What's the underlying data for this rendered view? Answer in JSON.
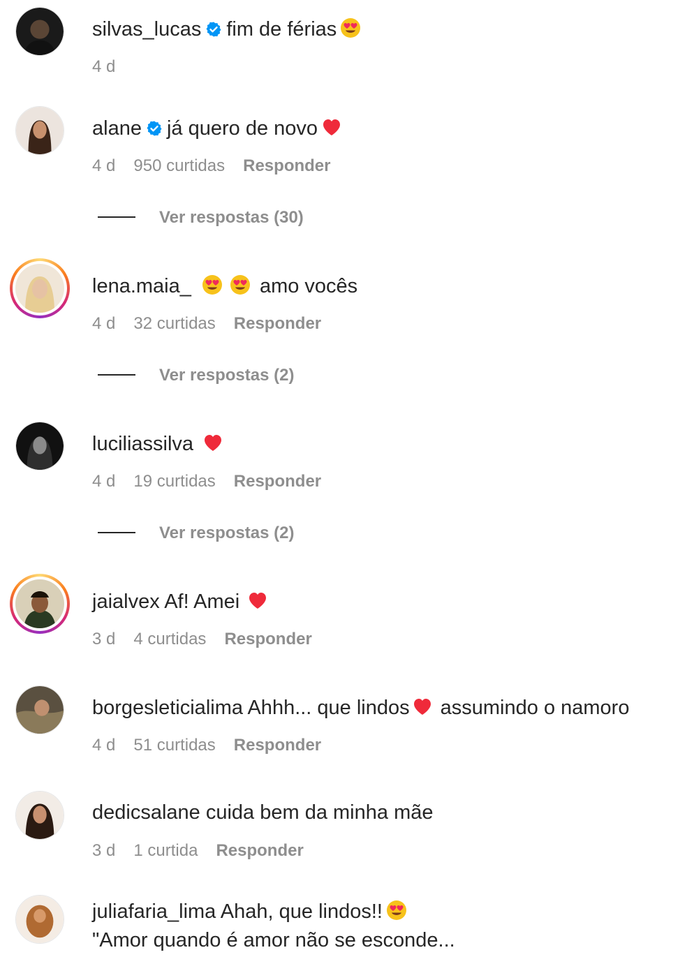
{
  "comments": [
    {
      "username": "silvas_lucas",
      "verified": true,
      "text": "fim de férias",
      "emoji": "heart-eyes",
      "time": "4 d",
      "likes": "",
      "reply": ""
    },
    {
      "username": "alane",
      "verified": true,
      "text": "já quero de novo",
      "emoji": "red-heart",
      "time": "4 d",
      "likes": "950 curtidas",
      "reply": "Responder",
      "view_replies": "Ver respostas (30)"
    },
    {
      "username": "lena.maia_",
      "text": "amo vocês",
      "time": "4 d",
      "likes": "32 curtidas",
      "reply": "Responder",
      "view_replies": "Ver respostas (2)"
    },
    {
      "username": "luciliassilva",
      "time": "4 d",
      "likes": "19 curtidas",
      "reply": "Responder",
      "view_replies": "Ver respostas (2)"
    },
    {
      "username": "jaialvex",
      "text": "Af! Amei",
      "time": "3 d",
      "likes": "4 curtidas",
      "reply": "Responder"
    },
    {
      "username": "borgesleticialima",
      "text": "Ahhh... que lindos",
      "text_after": "assumindo o namoro",
      "time": "4 d",
      "likes": "51 curtidas",
      "reply": "Responder"
    },
    {
      "username": "dedicsalane",
      "text": "cuida bem da minha mãe",
      "time": "3 d",
      "likes": "1 curtida",
      "reply": "Responder"
    },
    {
      "username": "juliafaria_lima",
      "text": "Ahah, que lindos!!",
      "text_line2": "\"Amor quando é amor não se esconde..."
    }
  ],
  "colors": {
    "text": "#262626",
    "muted": "#8e8e8e",
    "verified": "#0095f6",
    "heart": "#ff3040"
  }
}
